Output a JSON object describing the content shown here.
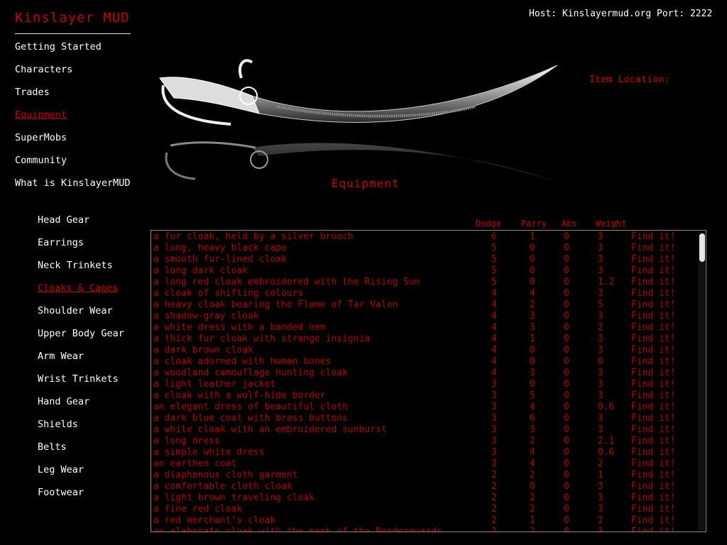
{
  "site": {
    "title": "Kinslayer MUD",
    "host_info": "Host: Kinslayermud.org Port: 2222"
  },
  "nav": {
    "items": [
      {
        "label": "Getting Started",
        "active": false
      },
      {
        "label": "Characters",
        "active": false
      },
      {
        "label": "Trades",
        "active": false
      },
      {
        "label": "Equipment",
        "active": true
      },
      {
        "label": "SuperMobs",
        "active": false
      },
      {
        "label": "Community",
        "active": false
      },
      {
        "label": "What is KinslayerMUD",
        "active": false
      }
    ]
  },
  "subnav": {
    "items": [
      {
        "label": "Head Gear",
        "active": false
      },
      {
        "label": "Earrings",
        "active": false
      },
      {
        "label": "Neck Trinkets",
        "active": false
      },
      {
        "label": "Cloaks & Capes",
        "active": true
      },
      {
        "label": "Shoulder Wear",
        "active": false
      },
      {
        "label": "Upper Body Gear",
        "active": false
      },
      {
        "label": "Arm Wear",
        "active": false
      },
      {
        "label": "Wrist Trinkets",
        "active": false
      },
      {
        "label": "Hand Gear",
        "active": false
      },
      {
        "label": "Shields",
        "active": false
      },
      {
        "label": "Belts",
        "active": false
      },
      {
        "label": "Leg Wear",
        "active": false
      },
      {
        "label": "Footwear",
        "active": false
      }
    ]
  },
  "banner": {
    "caption": "Equipment",
    "item_location_label": "Item Location:"
  },
  "table": {
    "columns": {
      "dodge": "Dodge",
      "parry": "Parry",
      "abs": "Abs",
      "weight": "Weight"
    },
    "find_label": "Find it!",
    "rows": [
      {
        "name": "a fur cloak, held by a silver brooch",
        "dodge": "6",
        "parry": "1",
        "abs": "0",
        "weight": "3"
      },
      {
        "name": "a long, heavy black cape",
        "dodge": "5",
        "parry": "0",
        "abs": "0",
        "weight": "3"
      },
      {
        "name": "a smooth fur-lined cloak",
        "dodge": "5",
        "parry": "0",
        "abs": "0",
        "weight": "3"
      },
      {
        "name": "a long dark cloak",
        "dodge": "5",
        "parry": "0",
        "abs": "0",
        "weight": "3"
      },
      {
        "name": "a long red cloak embroidered with the Rising Sun",
        "dodge": "5",
        "parry": "0",
        "abs": "0",
        "weight": "1.2"
      },
      {
        "name": "a cloak of shifting colours",
        "dodge": "4",
        "parry": "4",
        "abs": "0",
        "weight": "3"
      },
      {
        "name": "a heavy cloak bearing the Flame of Tar Valon",
        "dodge": "4",
        "parry": "2",
        "abs": "0",
        "weight": "5"
      },
      {
        "name": "a shadow-gray cloak",
        "dodge": "4",
        "parry": "3",
        "abs": "0",
        "weight": "3"
      },
      {
        "name": "a white dress with a banded hem",
        "dodge": "4",
        "parry": "3",
        "abs": "0",
        "weight": "2"
      },
      {
        "name": "a thick fur cloak with strange insignia",
        "dodge": "4",
        "parry": "1",
        "abs": "0",
        "weight": "3"
      },
      {
        "name": "a dark brown cloak",
        "dodge": "4",
        "parry": "0",
        "abs": "0",
        "weight": "3"
      },
      {
        "name": "a cloak adorned with human bones",
        "dodge": "4",
        "parry": "0",
        "abs": "0",
        "weight": "0"
      },
      {
        "name": "a woodland camouflage hunting cloak",
        "dodge": "4",
        "parry": "3",
        "abs": "0",
        "weight": "3"
      },
      {
        "name": "a light leather jacket",
        "dodge": "3",
        "parry": "0",
        "abs": "0",
        "weight": "3"
      },
      {
        "name": "a cloak with a wolf-hide border",
        "dodge": "3",
        "parry": "5",
        "abs": "0",
        "weight": "3"
      },
      {
        "name": "an elegant dress of beautiful cloth",
        "dodge": "3",
        "parry": "4",
        "abs": "0",
        "weight": "0.6"
      },
      {
        "name": "a dark blue coat with brass buttons",
        "dodge": "3",
        "parry": "6",
        "abs": "0",
        "weight": "3"
      },
      {
        "name": "a white cloak with an embroidered sunburst",
        "dodge": "3",
        "parry": "3",
        "abs": "0",
        "weight": "3"
      },
      {
        "name": "a long dress",
        "dodge": "3",
        "parry": "2",
        "abs": "0",
        "weight": "2.1"
      },
      {
        "name": "a simple white dress",
        "dodge": "3",
        "parry": "4",
        "abs": "0",
        "weight": "0.6"
      },
      {
        "name": "an earthen coat",
        "dodge": "3",
        "parry": "4",
        "abs": "0",
        "weight": "2"
      },
      {
        "name": "a diaphanous cloth garment",
        "dodge": "2",
        "parry": "2",
        "abs": "0",
        "weight": "1"
      },
      {
        "name": "a comfortable cloth cloak",
        "dodge": "2",
        "parry": "0",
        "abs": "0",
        "weight": "3"
      },
      {
        "name": "a light brown traveling cloak",
        "dodge": "2",
        "parry": "2",
        "abs": "0",
        "weight": "3"
      },
      {
        "name": "a fine red cloak",
        "dodge": "2",
        "parry": "2",
        "abs": "0",
        "weight": "3"
      },
      {
        "name": "a red merchant's cloak",
        "dodge": "2",
        "parry": "1",
        "abs": "0",
        "weight": "2"
      },
      {
        "name": "an elaborate cloak with the mark of the Borderguards",
        "dodge": "2",
        "parry": "2",
        "abs": "0",
        "weight": "3"
      }
    ]
  },
  "colors": {
    "accent": "#c80000",
    "row_text": "#b40000",
    "background": "#000000"
  }
}
